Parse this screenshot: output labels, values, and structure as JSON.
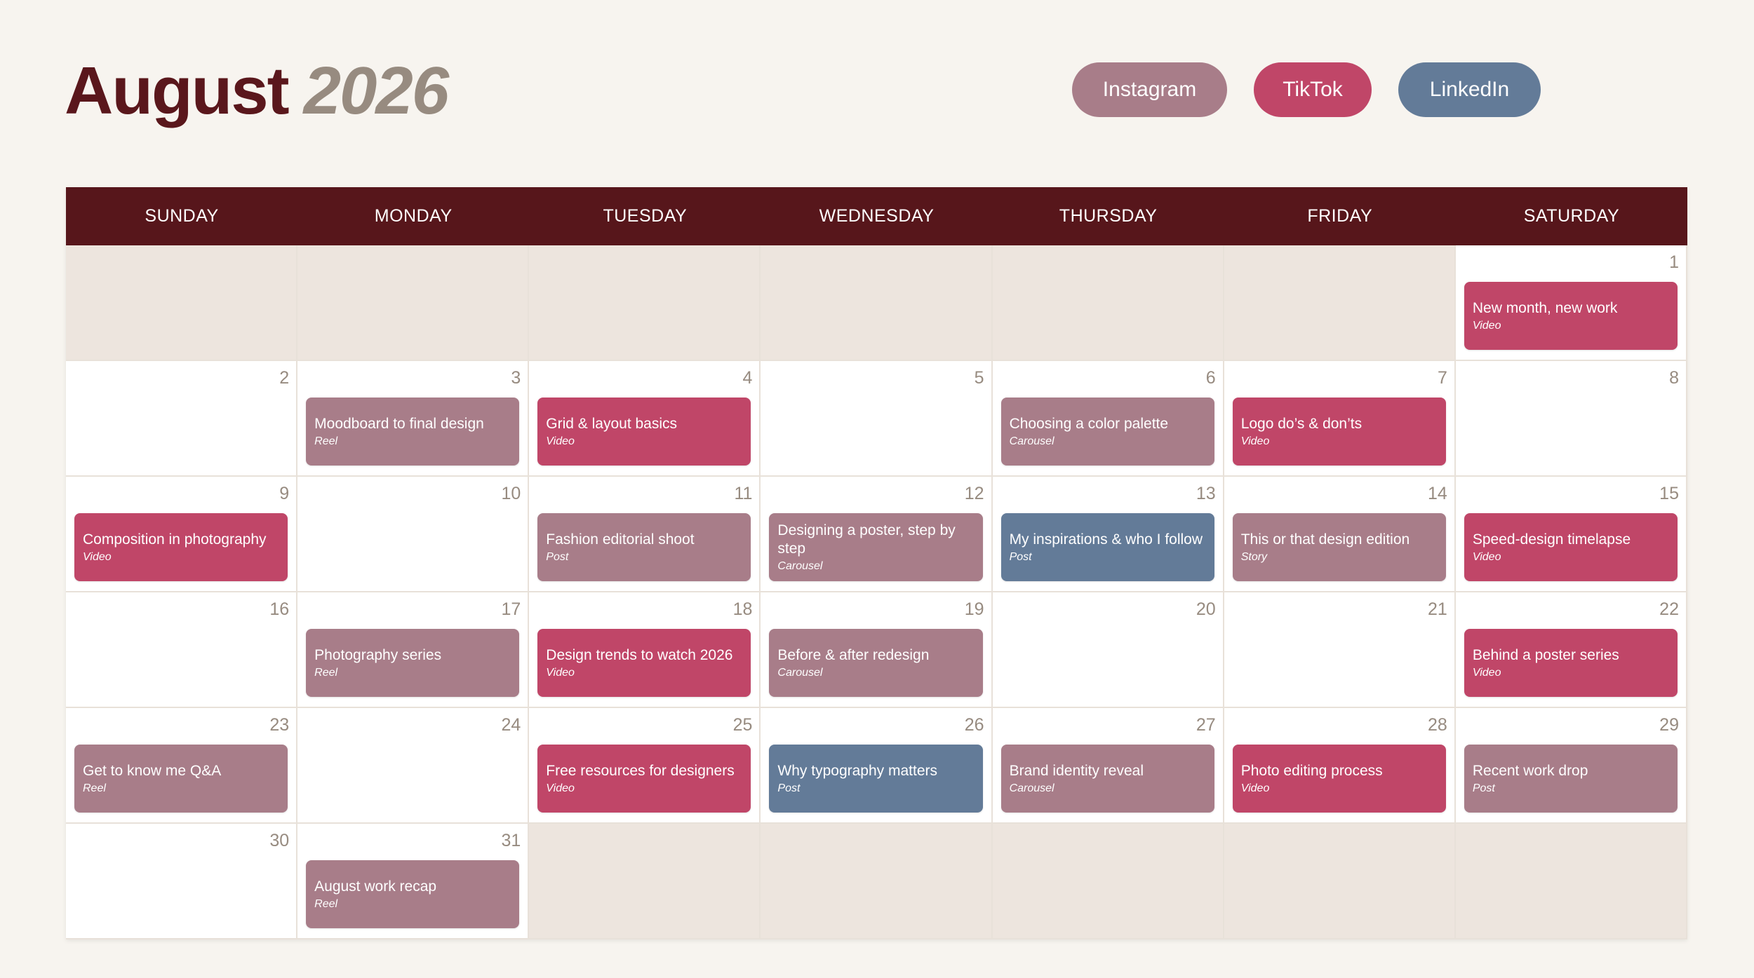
{
  "header": {
    "month": "August",
    "year": "2026"
  },
  "legend": [
    {
      "label": "Instagram",
      "color": "#a87d89"
    },
    {
      "label": "TikTok",
      "color": "#c04668"
    },
    {
      "label": "LinkedIn",
      "color": "#637b98"
    }
  ],
  "weekdays": [
    "SUNDAY",
    "MONDAY",
    "TUESDAY",
    "WEDNESDAY",
    "THURSDAY",
    "FRIDAY",
    "SATURDAY"
  ],
  "leading_blank_days": 6,
  "days": [
    {
      "day": "1",
      "event": {
        "title": "New month, new work",
        "type": "Video",
        "platform": "TikTok"
      }
    },
    {
      "day": "2"
    },
    {
      "day": "3",
      "event": {
        "title": "Moodboard to final design",
        "type": "Reel",
        "platform": "Instagram"
      }
    },
    {
      "day": "4",
      "event": {
        "title": "Grid & layout basics",
        "type": "Video",
        "platform": "TikTok"
      }
    },
    {
      "day": "5"
    },
    {
      "day": "6",
      "event": {
        "title": "Choosing a color palette",
        "type": "Carousel",
        "platform": "Instagram"
      }
    },
    {
      "day": "7",
      "event": {
        "title": "Logo do’s & don’ts",
        "type": "Video",
        "platform": "TikTok"
      }
    },
    {
      "day": "8"
    },
    {
      "day": "9",
      "event": {
        "title": "Composition in photography",
        "type": "Video",
        "platform": "TikTok"
      }
    },
    {
      "day": "10"
    },
    {
      "day": "11",
      "event": {
        "title": "Fashion editorial shoot",
        "type": "Post",
        "platform": "Instagram"
      }
    },
    {
      "day": "12",
      "event": {
        "title": "Designing a poster, step by step",
        "type": "Carousel",
        "platform": "Instagram"
      }
    },
    {
      "day": "13",
      "event": {
        "title": "My inspirations & who I follow",
        "type": "Post",
        "platform": "LinkedIn"
      }
    },
    {
      "day": "14",
      "event": {
        "title": "This or that  design edition",
        "type": "Story",
        "platform": "Instagram"
      }
    },
    {
      "day": "15",
      "event": {
        "title": "Speed-design timelapse",
        "type": "Video",
        "platform": "TikTok"
      }
    },
    {
      "day": "16"
    },
    {
      "day": "17",
      "event": {
        "title": "Photography series",
        "type": "Reel",
        "platform": "Instagram"
      }
    },
    {
      "day": "18",
      "event": {
        "title": "Design trends to watch 2026",
        "type": "Video",
        "platform": "TikTok"
      }
    },
    {
      "day": "19",
      "event": {
        "title": "Before & after redesign",
        "type": "Carousel",
        "platform": "Instagram"
      }
    },
    {
      "day": "20"
    },
    {
      "day": "21"
    },
    {
      "day": "22",
      "event": {
        "title": "Behind a poster series",
        "type": "Video",
        "platform": "TikTok"
      }
    },
    {
      "day": "23",
      "event": {
        "title": "Get to know me  Q&A",
        "type": "Reel",
        "platform": "Instagram"
      }
    },
    {
      "day": "24"
    },
    {
      "day": "25",
      "event": {
        "title": "Free resources for designers",
        "type": "Video",
        "platform": "TikTok"
      }
    },
    {
      "day": "26",
      "event": {
        "title": "Why typography matters",
        "type": "Post",
        "platform": "LinkedIn"
      }
    },
    {
      "day": "27",
      "event": {
        "title": "Brand identity reveal",
        "type": "Carousel",
        "platform": "Instagram"
      }
    },
    {
      "day": "28",
      "event": {
        "title": "Photo editing process",
        "type": "Video",
        "platform": "TikTok"
      }
    },
    {
      "day": "29",
      "event": {
        "title": "Recent work drop",
        "type": "Post",
        "platform": "Instagram"
      }
    },
    {
      "day": "30"
    },
    {
      "day": "31",
      "event": {
        "title": "August work recap",
        "type": "Reel",
        "platform": "Instagram"
      }
    }
  ],
  "trailing_blank_days": 5
}
